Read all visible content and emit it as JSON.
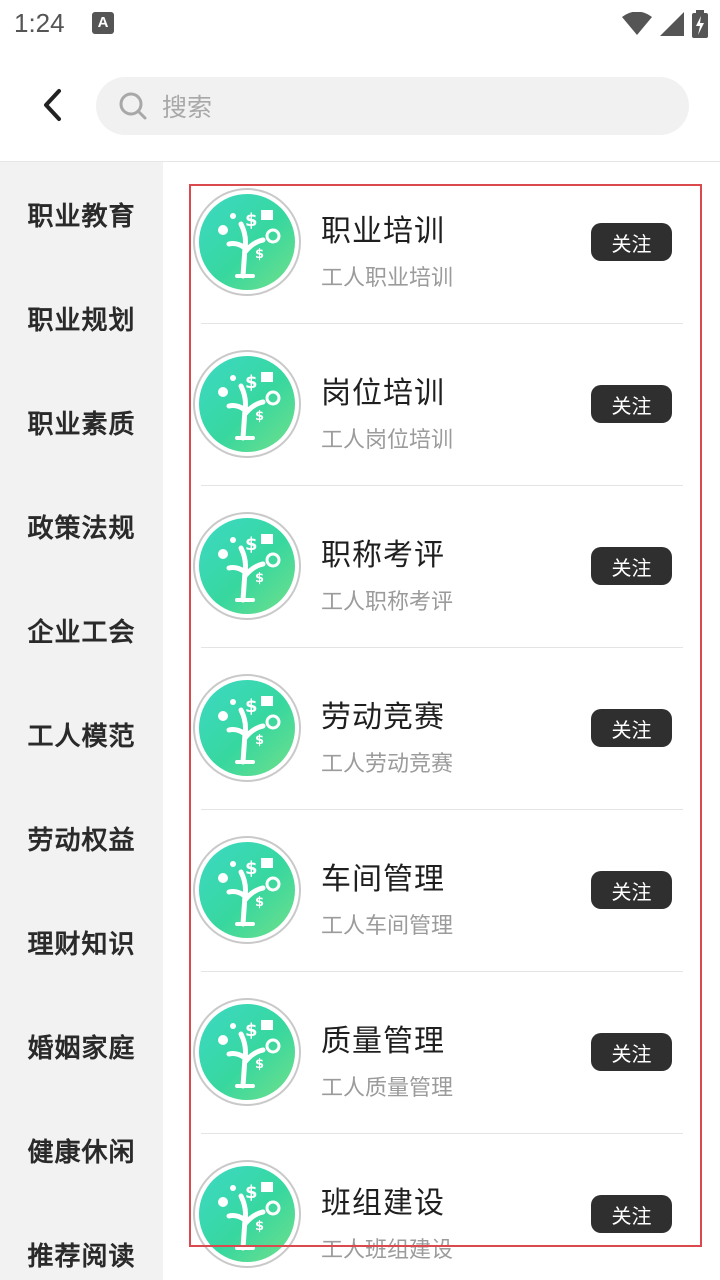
{
  "status_bar": {
    "time": "1:24",
    "notif_glyph": "A"
  },
  "header": {
    "search_placeholder": "搜索"
  },
  "sidebar": {
    "items": [
      {
        "label": "职业教育"
      },
      {
        "label": "职业规划"
      },
      {
        "label": "职业素质"
      },
      {
        "label": "政策法规"
      },
      {
        "label": "企业工会"
      },
      {
        "label": "工人模范"
      },
      {
        "label": "劳动权益"
      },
      {
        "label": "理财知识"
      },
      {
        "label": "婚姻家庭"
      },
      {
        "label": "健康休闲"
      },
      {
        "label": "推荐阅读"
      }
    ]
  },
  "list": {
    "items": [
      {
        "title": "职业培训",
        "subtitle": "工人职业培训",
        "button": "关注"
      },
      {
        "title": "岗位培训",
        "subtitle": "工人岗位培训",
        "button": "关注"
      },
      {
        "title": "职称考评",
        "subtitle": "工人职称考评",
        "button": "关注"
      },
      {
        "title": "劳动竞赛",
        "subtitle": "工人劳动竞赛",
        "button": "关注"
      },
      {
        "title": "车间管理",
        "subtitle": "工人车间管理",
        "button": "关注"
      },
      {
        "title": "质量管理",
        "subtitle": "工人质量管理",
        "button": "关注"
      },
      {
        "title": "班组建设",
        "subtitle": "工人班组建设",
        "button": "关注"
      }
    ]
  },
  "colors": {
    "accent_box": "#d9494d",
    "follow_button": "#2f2f2f",
    "avatar_green": "#37d79f"
  }
}
